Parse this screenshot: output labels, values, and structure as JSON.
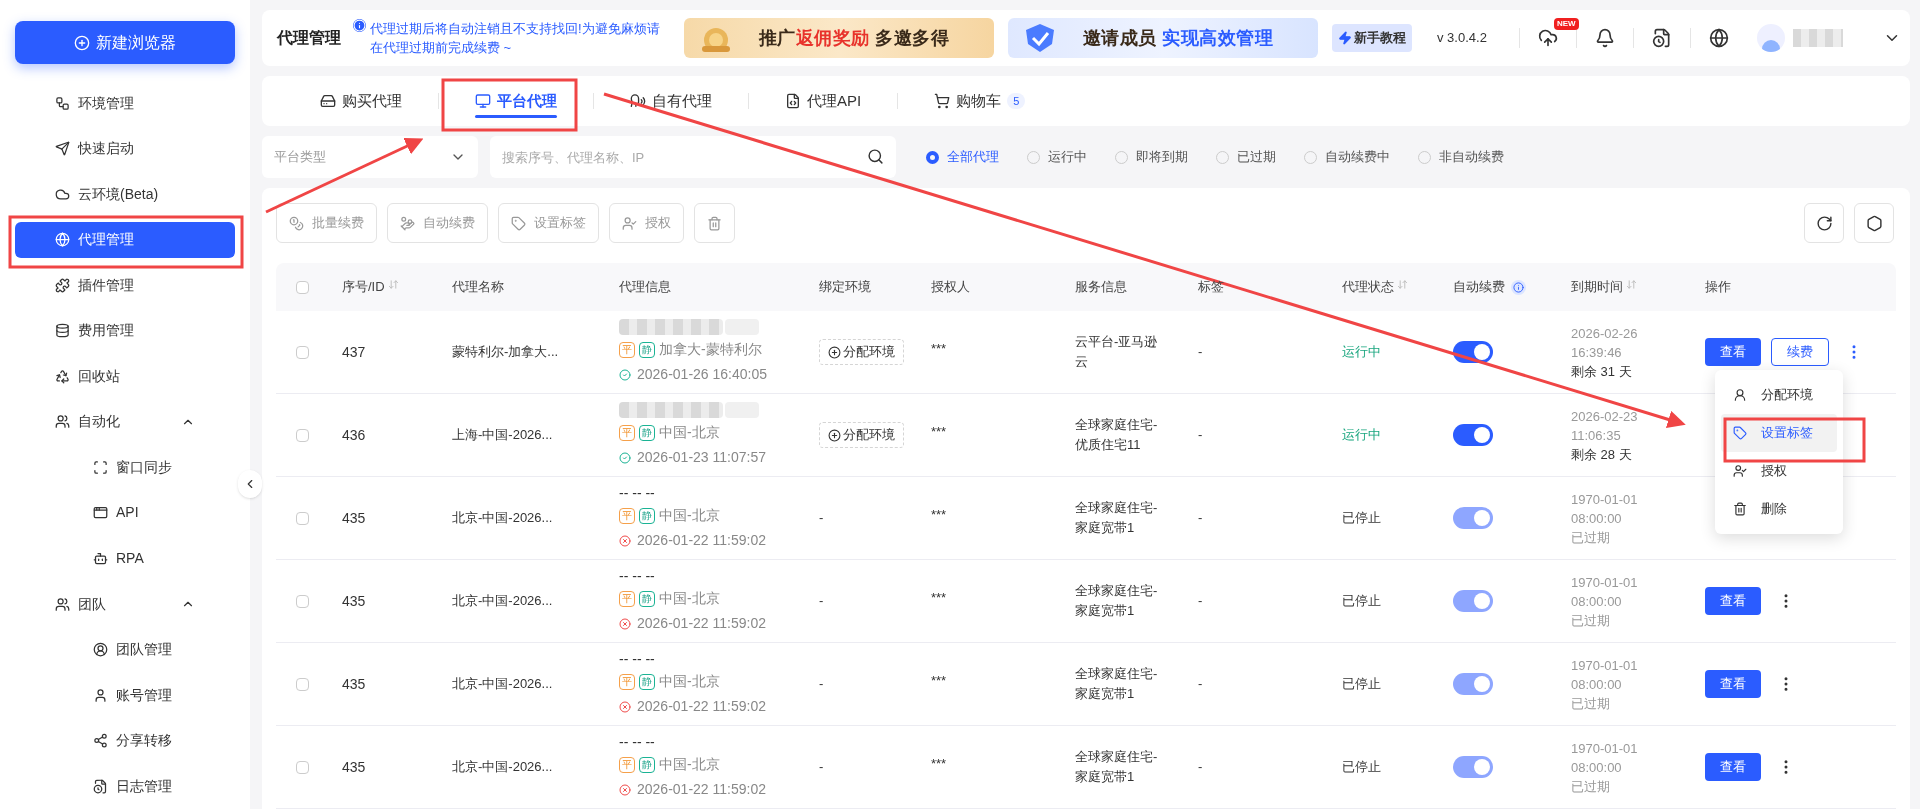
{
  "sidebar": {
    "new_button": "新建浏览器",
    "items": [
      {
        "label": "环境管理",
        "selected": false
      },
      {
        "label": "快速启动",
        "selected": false
      },
      {
        "label": "云环境(Beta)",
        "selected": false
      },
      {
        "label": "代理管理",
        "selected": true
      },
      {
        "label": "插件管理",
        "selected": false
      },
      {
        "label": "费用管理",
        "selected": false
      },
      {
        "label": "回收站",
        "selected": false
      },
      {
        "label": "自动化",
        "selected": false,
        "expanded": true,
        "children": [
          {
            "label": "窗口同步",
            "selected": false
          },
          {
            "label": "API",
            "selected": false
          },
          {
            "label": "RPA",
            "selected": false
          }
        ]
      },
      {
        "label": "团队",
        "selected": false,
        "expanded": true,
        "children": [
          {
            "label": "团队管理",
            "selected": false
          },
          {
            "label": "账号管理",
            "selected": false
          },
          {
            "label": "分享转移",
            "selected": false
          },
          {
            "label": "日志管理",
            "selected": false
          }
        ]
      }
    ]
  },
  "header": {
    "title": "代理管理",
    "notice": "代理过期后将自动注销且不支持找回!为避免麻烦请在代理过期前完成续费 ~",
    "banners": [
      {
        "parts": [
          {
            "text": "推广",
            "accent": false
          },
          {
            "text": "返佣奖励",
            "accent": true
          },
          {
            "text": " 多邀多得",
            "accent": false
          }
        ]
      },
      {
        "parts": [
          {
            "text": "邀请成员 ",
            "accent": false
          },
          {
            "text": "实现高效管理",
            "accent": true
          }
        ]
      }
    ],
    "tutorial": "新手教程",
    "version": "v 3.0.4.2",
    "new_badge": "NEW"
  },
  "tabs": [
    {
      "label": "购买代理",
      "selected": false
    },
    {
      "label": "平台代理",
      "selected": true
    },
    {
      "label": "自有代理",
      "selected": false
    },
    {
      "label": "代理API",
      "selected": false
    },
    {
      "label": "购物车",
      "selected": false,
      "badge": "5"
    }
  ],
  "filters": {
    "platform_select": {
      "placeholder": "平台类型"
    },
    "search": {
      "placeholder": "搜索序号、代理名称、IP"
    },
    "radios": [
      {
        "label": "全部代理",
        "selected": true
      },
      {
        "label": "运行中",
        "selected": false
      },
      {
        "label": "即将到期",
        "selected": false
      },
      {
        "label": "已过期",
        "selected": false
      },
      {
        "label": "自动续费中",
        "selected": false
      },
      {
        "label": "非自动续费",
        "selected": false
      }
    ]
  },
  "toolbar": {
    "buttons": [
      {
        "label": "批量续费",
        "disabled": true
      },
      {
        "label": "自动续费",
        "disabled": true
      },
      {
        "label": "设置标签",
        "disabled": true
      },
      {
        "label": "授权",
        "disabled": true
      },
      {
        "disabled": true
      }
    ]
  },
  "table": {
    "select_all": {
      "checked": false
    },
    "columns": [
      {
        "label": "序号/ID",
        "sortable": true,
        "hint": false
      },
      {
        "label": "代理名称",
        "sortable": false,
        "hint": false
      },
      {
        "label": "代理信息",
        "sortable": false,
        "hint": false
      },
      {
        "label": "绑定环境",
        "sortable": false,
        "hint": false
      },
      {
        "label": "授权人",
        "sortable": false,
        "hint": false
      },
      {
        "label": "服务信息",
        "sortable": false,
        "hint": false
      },
      {
        "label": "标签",
        "sortable": false,
        "hint": false
      },
      {
        "label": "代理状态",
        "sortable": true,
        "hint": false
      },
      {
        "label": "自动续费",
        "sortable": false,
        "hint": true
      },
      {
        "label": "到期时间",
        "sortable": true,
        "hint": false
      },
      {
        "label": "操作",
        "sortable": false,
        "hint": false
      }
    ],
    "rows": [
      {
        "checked": false,
        "id": "437",
        "name": "蒙特利尔-加拿大...",
        "ip_hidden": true,
        "tags": [
          "平",
          "静"
        ],
        "location": "加拿大-蒙特利尔",
        "valid": true,
        "created": "2026-01-26 16:40:05",
        "binding": {
          "kind": "button",
          "label": "分配环境"
        },
        "authorizer": "***",
        "service": "云平台-亚马逊云",
        "tag": "-",
        "status": {
          "kind": "running",
          "label": "运行中"
        },
        "auto_renew": {
          "on": true,
          "disabled": false
        },
        "expiry": {
          "date": "2026-02-26",
          "time": "16:39:46",
          "remaining": "剩余 31 天",
          "expired": false
        },
        "actions": [
          {
            "kind": "primary",
            "label": "查看"
          },
          {
            "kind": "outline",
            "label": "续费"
          },
          {
            "kind": "more",
            "active": true
          }
        ]
      },
      {
        "checked": false,
        "id": "436",
        "name": "上海-中国-2026...",
        "ip_hidden": true,
        "tags": [
          "平",
          "静"
        ],
        "location": "中国-北京",
        "valid": true,
        "created": "2026-01-23 11:07:57",
        "binding": {
          "kind": "button",
          "label": "分配环境"
        },
        "authorizer": "***",
        "service": "全球家庭住宅-优质住宅11",
        "tag": "-",
        "status": {
          "kind": "running",
          "label": "运行中"
        },
        "auto_renew": {
          "on": true,
          "disabled": false
        },
        "expiry": {
          "date": "2026-02-23",
          "time": "11:06:35",
          "remaining": "剩余 28 天",
          "expired": false
        },
        "actions": []
      },
      {
        "checked": false,
        "id": "435",
        "name": "北京-中国-2026...",
        "ip": "-- -- --",
        "ip_hidden": false,
        "tags": [
          "平",
          "静"
        ],
        "location": "中国-北京",
        "valid": false,
        "created": "2026-01-22 11:59:02",
        "binding": {
          "kind": "text",
          "label": "-"
        },
        "authorizer": "***",
        "service": "全球家庭住宅-家庭宽带1",
        "tag": "-",
        "status": {
          "kind": "stopped",
          "label": "已停止"
        },
        "auto_renew": {
          "on": true,
          "disabled": true
        },
        "expiry": {
          "date": "1970-01-01",
          "time": "08:00:00",
          "remaining": "已过期",
          "expired": true
        },
        "actions": []
      },
      {
        "checked": false,
        "id": "435",
        "name": "北京-中国-2026...",
        "ip": "-- -- --",
        "ip_hidden": false,
        "tags": [
          "平",
          "静"
        ],
        "location": "中国-北京",
        "valid": false,
        "created": "2026-01-22 11:59:02",
        "binding": {
          "kind": "text",
          "label": "-"
        },
        "authorizer": "***",
        "service": "全球家庭住宅-家庭宽带1",
        "tag": "-",
        "status": {
          "kind": "stopped",
          "label": "已停止"
        },
        "auto_renew": {
          "on": true,
          "disabled": true
        },
        "expiry": {
          "date": "1970-01-01",
          "time": "08:00:00",
          "remaining": "已过期",
          "expired": true
        },
        "actions": [
          {
            "kind": "primary",
            "label": "查看"
          },
          {
            "kind": "more",
            "active": false
          }
        ]
      },
      {
        "checked": false,
        "id": "435",
        "name": "北京-中国-2026...",
        "ip": "-- -- --",
        "ip_hidden": false,
        "tags": [
          "平",
          "静"
        ],
        "location": "中国-北京",
        "valid": false,
        "created": "2026-01-22 11:59:02",
        "binding": {
          "kind": "text",
          "label": "-"
        },
        "authorizer": "***",
        "service": "全球家庭住宅-家庭宽带1",
        "tag": "-",
        "status": {
          "kind": "stopped",
          "label": "已停止"
        },
        "auto_renew": {
          "on": true,
          "disabled": true
        },
        "expiry": {
          "date": "1970-01-01",
          "time": "08:00:00",
          "remaining": "已过期",
          "expired": true
        },
        "actions": [
          {
            "kind": "primary",
            "label": "查看"
          },
          {
            "kind": "more",
            "active": false
          }
        ]
      },
      {
        "checked": false,
        "id": "435",
        "name": "北京-中国-2026...",
        "ip": "-- -- --",
        "ip_hidden": false,
        "tags": [
          "平",
          "静"
        ],
        "location": "中国-北京",
        "valid": false,
        "created": "2026-01-22 11:59:02",
        "binding": {
          "kind": "text",
          "label": "-"
        },
        "authorizer": "***",
        "service": "全球家庭住宅-家庭宽带1",
        "tag": "-",
        "status": {
          "kind": "stopped",
          "label": "已停止"
        },
        "auto_renew": {
          "on": true,
          "disabled": true
        },
        "expiry": {
          "date": "1970-01-01",
          "time": "08:00:00",
          "remaining": "已过期",
          "expired": true
        },
        "actions": [
          {
            "kind": "primary",
            "label": "查看"
          },
          {
            "kind": "more",
            "active": false
          }
        ]
      }
    ]
  },
  "row_menu": {
    "items": [
      {
        "label": "分配环境",
        "selected": false
      },
      {
        "label": "设置标签",
        "selected": true
      },
      {
        "label": "授权",
        "selected": false
      },
      {
        "label": "删除",
        "selected": false
      }
    ]
  }
}
